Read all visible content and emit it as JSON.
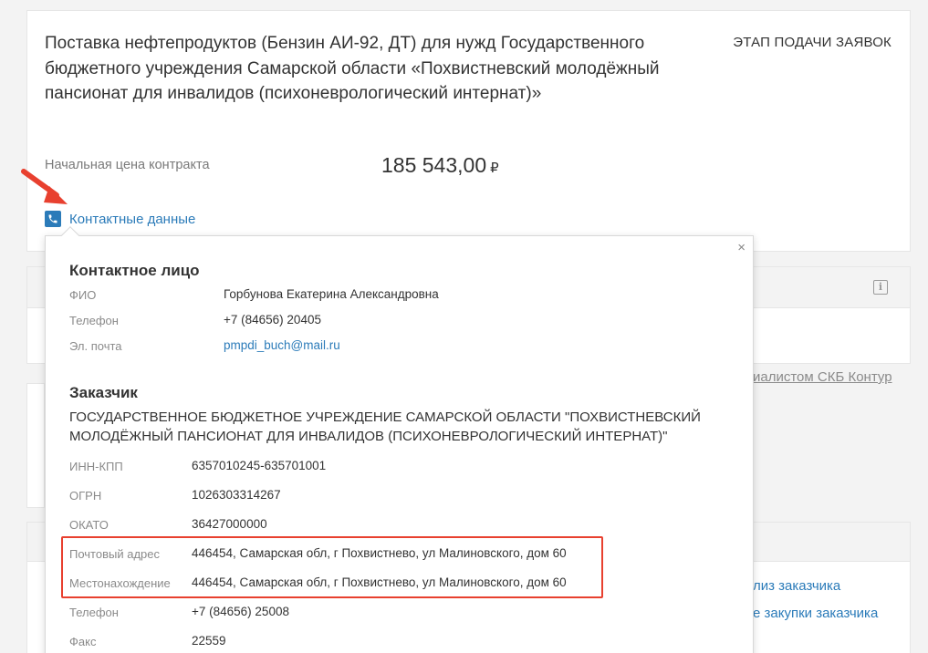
{
  "tender": {
    "title": "Поставка нефтепродуктов (Бензин АИ-92, ДТ) для нужд Государственного бюджетного учреждения Самарской области «Похвистневский молодёжный пансионат для инвалидов (психоневрологический интернат)»",
    "stage": "ЭТАП ПОДАЧИ ЗАЯВОК",
    "price_label": "Начальная цена контракта",
    "price_value": "185 543,00",
    "currency": "₽",
    "contact_link": "Контактные данные"
  },
  "behind": {
    "specialist": "иалистом СКБ Контур",
    "analysis": "лиз заказчика",
    "purchases": "е закупки заказчика"
  },
  "popup": {
    "close": "×",
    "contact_person": {
      "title": "Контактное лицо",
      "rows": [
        {
          "label": "ФИО",
          "value": "Горбунова Екатерина Александровна"
        },
        {
          "label": "Телефон",
          "value": "+7 (84656) 20405"
        },
        {
          "label": "Эл. почта",
          "value": "pmpdi_buch@mail.ru"
        }
      ]
    },
    "customer": {
      "title": "Заказчик",
      "name": "ГОСУДАРСТВЕННОЕ БЮДЖЕТНОЕ УЧРЕЖДЕНИЕ САМАРСКОЙ ОБЛАСТИ \"ПОХВИСТНЕВСКИЙ МОЛОДЁЖНЫЙ ПАНСИОНАТ ДЛЯ ИНВАЛИДОВ (ПСИХОНЕВРОЛОГИЧЕСКИЙ ИНТЕРНАТ)\"",
      "rows": [
        {
          "label": "ИНН-КПП",
          "value": "6357010245-635701001"
        },
        {
          "label": "ОГРН",
          "value": "1026303314267"
        },
        {
          "label": "ОКАТО",
          "value": "36427000000"
        },
        {
          "label": "Почтовый адрес",
          "value": "446454, Самарская обл, г Похвистнево, ул Малиновского, дом 60"
        },
        {
          "label": "Местонахождение",
          "value": "446454, Самарская обл, г Похвистнево, ул Малиновского, дом 60"
        },
        {
          "label": "Телефон",
          "value": "+7 (84656) 25008"
        },
        {
          "label": "Факс",
          "value": "22559"
        }
      ]
    }
  },
  "colors": {
    "link": "#2b7bb9",
    "highlight": "#e8402f",
    "arrow": "#e8402f"
  }
}
